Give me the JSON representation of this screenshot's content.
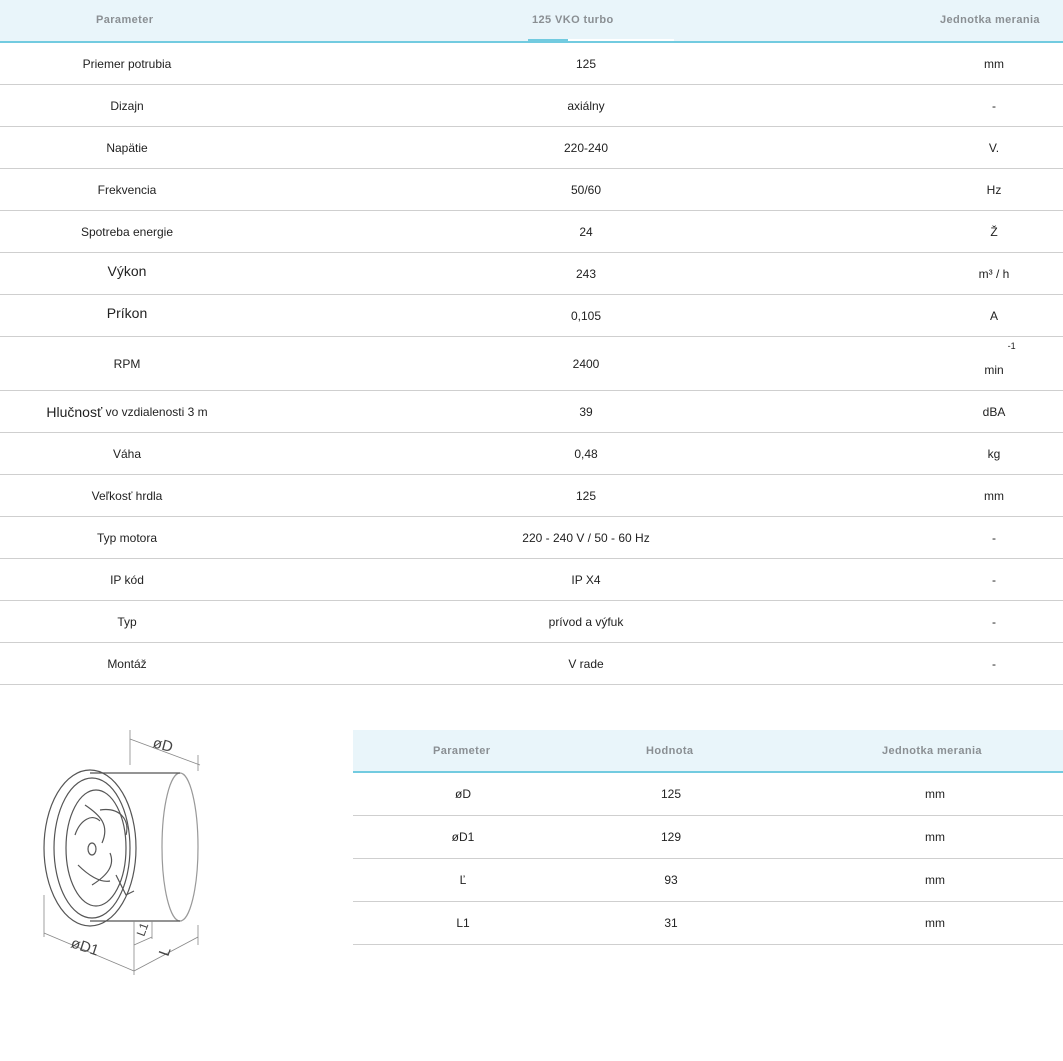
{
  "spec_table": {
    "headers": {
      "parameter": "Parameter",
      "model": "125 VKO turbo",
      "unit": "Jednotka merania"
    },
    "rows": [
      {
        "param": "Priemer potrubia",
        "value": "125",
        "unit": "mm"
      },
      {
        "param": "Dizajn",
        "value": "axiálny",
        "unit": "-"
      },
      {
        "param": "Napätie",
        "value": "220-240",
        "unit": "V."
      },
      {
        "param": "Frekvencia",
        "value": "50/60",
        "unit": "Hz"
      },
      {
        "param": "Spotreba energie",
        "value": "24",
        "unit": "Ž"
      },
      {
        "param": "Výkon",
        "value": "243",
        "unit": "m³ / h"
      },
      {
        "param": "Príkon",
        "value": "0,105",
        "unit": "A"
      },
      {
        "param": "RPM",
        "value": "2400",
        "unit": "min",
        "unit_sup": "-1"
      },
      {
        "param": "Hlučnosť",
        "param_suffix": "vo vzdialenosti 3 m",
        "value": "39",
        "unit": "dBA"
      },
      {
        "param": "Váha",
        "value": "0,48",
        "unit": "kg"
      },
      {
        "param": "Veľkosť hrdla",
        "value": "125",
        "unit": "mm"
      },
      {
        "param": "Typ motora",
        "value": "220 - 240 V / 50 - 60 Hz",
        "unit": "-"
      },
      {
        "param": "IP kód",
        "value": "IP X4",
        "unit": "-"
      },
      {
        "param": "Typ",
        "value": "prívod a výfuk",
        "unit": "-"
      },
      {
        "param": "Montáž",
        "value": "V rade",
        "unit": "-"
      }
    ]
  },
  "dimension_table": {
    "headers": {
      "parameter": "Parameter",
      "value": "Hodnota",
      "unit": "Jednotka merania"
    },
    "rows": [
      {
        "param": "øD",
        "value": "125",
        "unit": "mm"
      },
      {
        "param": "øD1",
        "value": "129",
        "unit": "mm"
      },
      {
        "param": "Ľ",
        "value": "93",
        "unit": "mm"
      },
      {
        "param": "L1",
        "value": "31",
        "unit": "mm"
      }
    ]
  },
  "drawing": {
    "label_d": "øD",
    "label_d1": "øD1",
    "label_l": "L",
    "label_l1": "L1"
  },
  "colors": {
    "header_bg": "#e9f5fa",
    "accent": "#72cbe0",
    "header_text": "#8a8f93",
    "row_border": "#cfcfcf"
  }
}
